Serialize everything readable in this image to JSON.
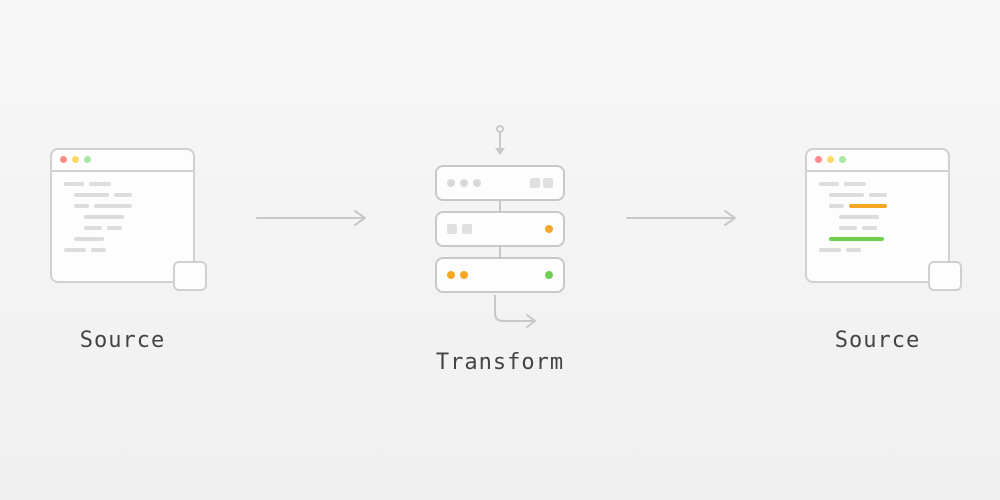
{
  "diagram": {
    "stages": {
      "source_left": {
        "label": "Source"
      },
      "transform": {
        "label": "Transform"
      },
      "source_right": {
        "label": "Source"
      }
    },
    "colors": {
      "frame": "#d0d0d0",
      "bg": "#f5f5f5",
      "accent_orange": "#f5a623",
      "accent_green": "#6fcf4f",
      "dot_red": "#ff8a8a",
      "dot_yellow": "#ffd966",
      "dot_green": "#a8e6a8"
    },
    "code_badge": "</>"
  }
}
